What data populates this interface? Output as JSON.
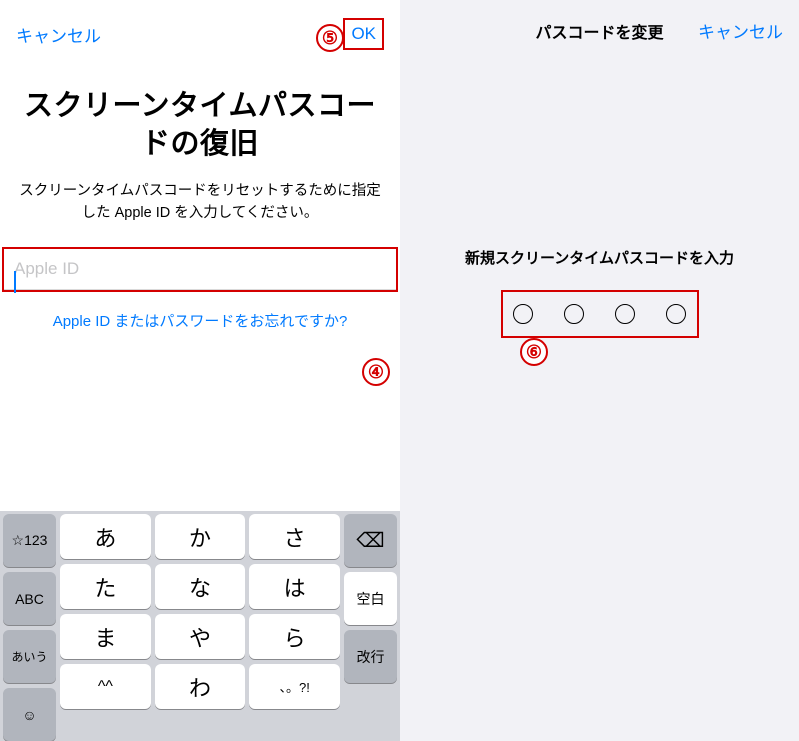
{
  "left": {
    "nav": {
      "cancel": "キャンセル",
      "ok": "OK"
    },
    "title": "スクリーンタイムパスコードの復旧",
    "subtitle": "スクリーンタイムパスコードをリセットするために指定した Apple ID を入力してください。",
    "input": {
      "placeholder": "Apple ID",
      "value": ""
    },
    "forgot": "Apple ID またはパスワードをお忘れですか?",
    "keyboard": {
      "side_left": [
        "☆123",
        "ABC",
        "あいう",
        "☺"
      ],
      "kana": [
        [
          "あ",
          "か",
          "さ"
        ],
        [
          "た",
          "な",
          "は"
        ],
        [
          "ま",
          "や",
          "ら"
        ],
        [
          "^^",
          "わ",
          "、。?!"
        ]
      ],
      "side_right": {
        "backspace": "⌫",
        "space": "空白",
        "enter": "改行"
      }
    },
    "annotations": {
      "four": "④",
      "five": "⑤"
    }
  },
  "right": {
    "nav": {
      "title": "パスコードを変更",
      "cancel": "キャンセル"
    },
    "prompt": "新規スクリーンタイムパスコードを入力",
    "annotations": {
      "six": "⑥"
    }
  }
}
